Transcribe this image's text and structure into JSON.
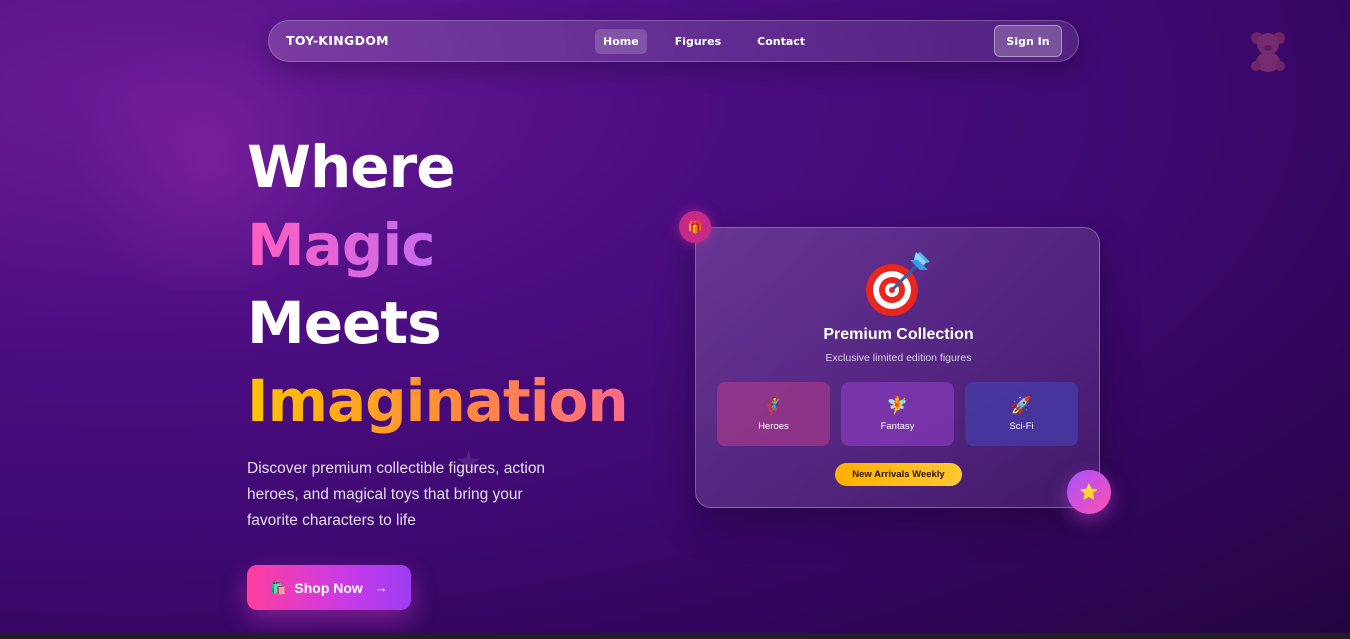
{
  "nav": {
    "brand": "TOY-KINGDOM",
    "links": [
      {
        "label": "Home",
        "active": true
      },
      {
        "label": "Figures",
        "active": false
      },
      {
        "label": "Contact",
        "active": false
      }
    ],
    "sign_in": "Sign In"
  },
  "hero": {
    "line1": "Where",
    "line2": "Magic",
    "line3": "Meets",
    "line4": "Imagination",
    "description": "Discover premium collectible figures, action heroes, and magical toys that bring your favorite characters to life",
    "cta_icon": "🛍️",
    "cta_label": "Shop Now",
    "cta_arrow": "→"
  },
  "card": {
    "icon": "target-dart-icon",
    "title": "Premium Collection",
    "subtitle": "Exclusive limited edition figures",
    "categories": [
      {
        "emoji": "🦸",
        "label": "Heroes"
      },
      {
        "emoji": "🧚",
        "label": "Fantasy"
      },
      {
        "emoji": "🚀",
        "label": "Sci-Fi"
      }
    ],
    "badge": "New Arrivals Weekly"
  },
  "floating": {
    "gift": "🎁",
    "star": "⭐"
  },
  "colors": {
    "accent_pink": "#ff3e9e",
    "accent_purple": "#9d3cf2",
    "accent_gold": "#ffc400",
    "background": "#4a0d80"
  }
}
